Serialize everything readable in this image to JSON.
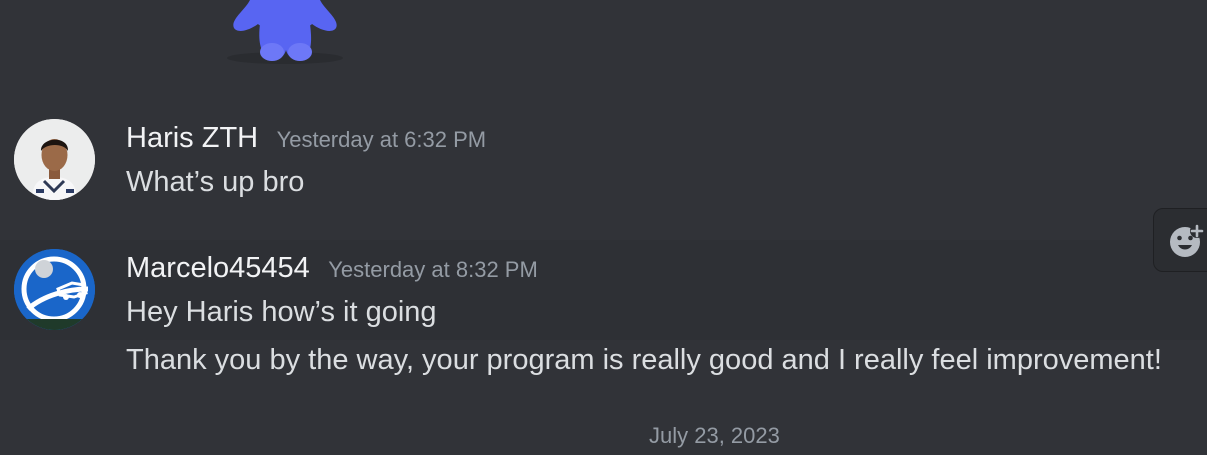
{
  "messages": [
    {
      "username": "Haris ZTH",
      "timestamp": "Yesterday at 6:32 PM",
      "lines": [
        "What’s up bro"
      ]
    },
    {
      "username": "Marcelo45454",
      "timestamp": "Yesterday at 8:32 PM",
      "lines": [
        "Hey Haris how’s it going",
        "Thank you by the way, your program is really good and I really feel improvement!"
      ]
    }
  ],
  "date_divider": "July 23, 2023",
  "icons": {
    "reaction": "add-reaction-icon",
    "mascot": "wumpus-mascot-icon"
  },
  "colors": {
    "background": "#313338",
    "hover_background": "#2e3035",
    "text": "#dbdee1",
    "username": "#f2f3f5",
    "muted": "#949ba4",
    "blurple": "#5865f2"
  }
}
